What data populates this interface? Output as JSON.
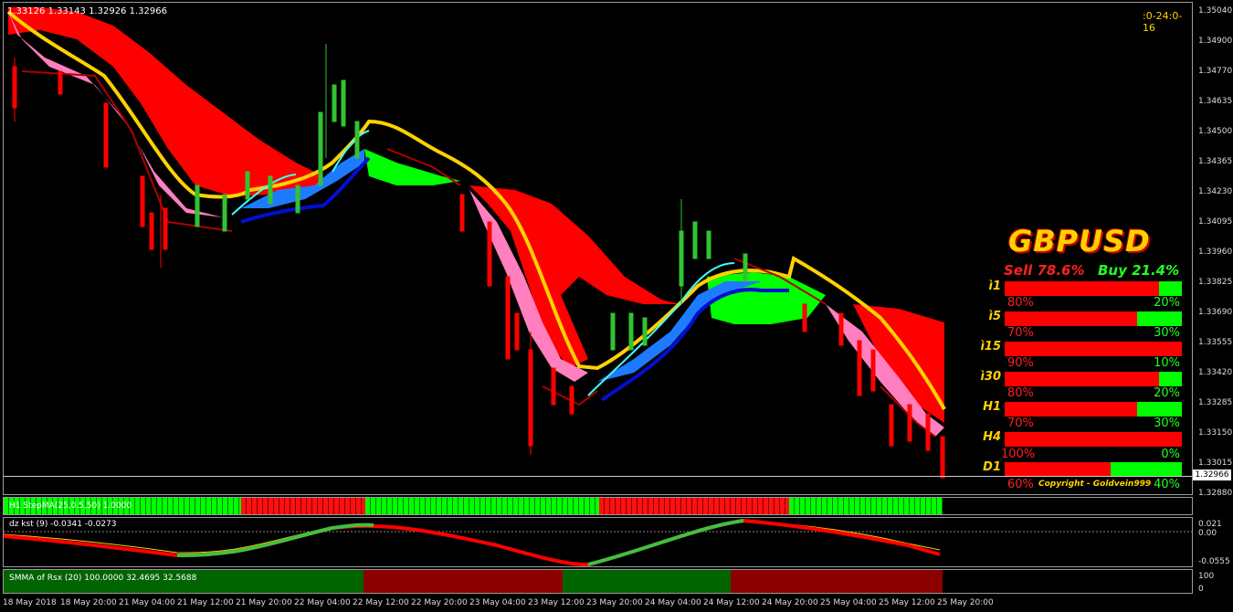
{
  "chart": {
    "ohlc_text": "1.33126 1.33143 1.32926 1.32966",
    "timer": ":0-24:0-16",
    "current_price": "1.32966",
    "price_axis": [
      "1.35040",
      "1.34900",
      "1.34770",
      "1.34635",
      "1.34500",
      "1.34365",
      "1.34230",
      "1.34095",
      "1.33960",
      "1.33825",
      "1.33690",
      "1.33555",
      "1.33420",
      "1.33285",
      "1.33150",
      "1.33015",
      "1.32880"
    ],
    "kst_axis": [
      "0.021",
      "0.00",
      "-0.0555"
    ],
    "smma_axis": [
      "100",
      "0"
    ],
    "date_axis": [
      "18 May 2018",
      "18 May 20:00",
      "21 May 04:00",
      "21 May 12:00",
      "21 May 20:00",
      "22 May 04:00",
      "22 May 12:00",
      "22 May 20:00",
      "23 May 04:00",
      "23 May 12:00",
      "23 May 20:00",
      "24 May 04:00",
      "24 May 12:00",
      "24 May 20:00",
      "25 May 04:00",
      "25 May 12:00",
      "25 May 20:00"
    ]
  },
  "dashboard": {
    "symbol": "GBPUSD",
    "sell_text": "Sell 78.6%",
    "buy_text": "Buy 21.4%",
    "copyright": "Copyright - Goldvein999",
    "colors": {
      "sell": "#ff0000",
      "buy": "#00ff00",
      "label": "#ffd200"
    },
    "timeframes": [
      {
        "label": "ì1",
        "sell": "80%",
        "buy": "20%",
        "buy_fraction": 0.2
      },
      {
        "label": "ì5",
        "sell": "70%",
        "buy": "30%",
        "buy_fraction": 0.3
      },
      {
        "label": "ì15",
        "sell": "90%",
        "buy": "10%",
        "buy_fraction": 0.1
      },
      {
        "label": "ì30",
        "sell": "80%",
        "buy": "20%",
        "buy_fraction": 0.2
      },
      {
        "label": "H1",
        "sell": "70%",
        "buy": "30%",
        "buy_fraction": 0.3
      },
      {
        "label": "H4",
        "sell": "100%",
        "buy": "0%",
        "buy_fraction": 0.0
      },
      {
        "label": "D1",
        "sell": "60%",
        "buy": "40%",
        "buy_fraction": 0.4
      }
    ]
  },
  "indicators": {
    "stepma_label": "H1 StepMA(25,0.5,50) 1.0000",
    "kst_label": "dz kst (9) -0.0341 -0.0273",
    "smma_label": "SMMA of Rsx (20) 100.0000 32.4695 32.5688"
  }
}
